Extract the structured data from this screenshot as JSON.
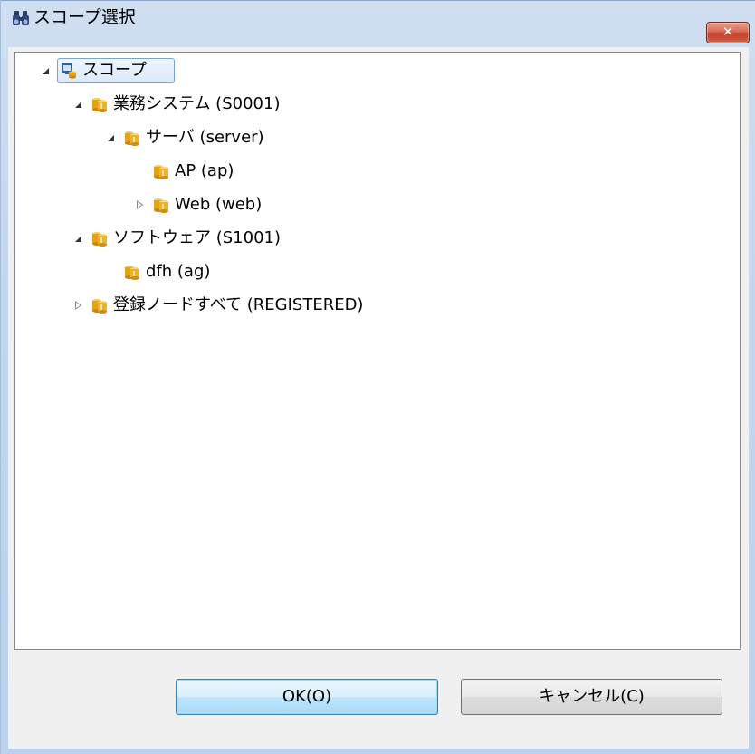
{
  "window": {
    "title": "スコープ選択",
    "close_label": "✕"
  },
  "tree": {
    "root": {
      "label": "スコープ",
      "expanded": true,
      "selected": true
    },
    "nodes": [
      {
        "label": "業務システム (S0001)",
        "level": 1,
        "toggle": "expanded"
      },
      {
        "label": "サーバ (server)",
        "level": 2,
        "toggle": "expanded"
      },
      {
        "label": "AP (ap)",
        "level": 3,
        "toggle": "none"
      },
      {
        "label": "Web (web)",
        "level": 3,
        "toggle": "collapsed"
      },
      {
        "label": "ソフトウェア (S1001)",
        "level": 1,
        "toggle": "expanded"
      },
      {
        "label": "dfh (ag)",
        "level": 2,
        "toggle": "none"
      },
      {
        "label": "登録ノードすべて (REGISTERED)",
        "level": 1,
        "toggle": "collapsed"
      }
    ]
  },
  "buttons": {
    "ok": "OK(O)",
    "cancel": "キャンセル(C)"
  },
  "colors": {
    "folder": "#e3a21a",
    "close": "#c2432a",
    "selection_border": "#7da2ce"
  }
}
